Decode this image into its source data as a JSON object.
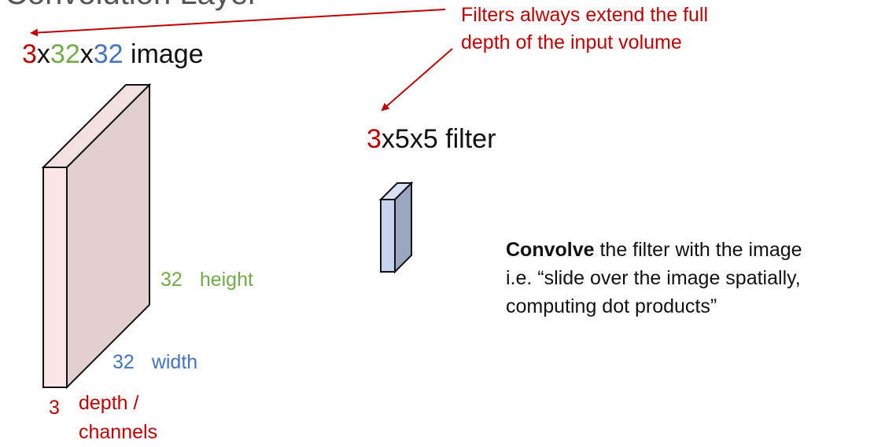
{
  "title_partial": "Convolution Layer",
  "image_label": {
    "depth": "3",
    "x1": "x",
    "height": "32",
    "x2": "x",
    "width": "32",
    "suffix": " image"
  },
  "filter_label": {
    "depth": "3",
    "rest": "x5x5 filter"
  },
  "note_top": {
    "line1": "Filters always extend the full",
    "line2": "depth of the input volume"
  },
  "dimensions": {
    "height_value": "32",
    "height_label": "height",
    "width_value": "32",
    "width_label": "width",
    "depth_value": "3",
    "depth_label": "depth / channels"
  },
  "convolve": {
    "bold": "Convolve",
    "line1_rest": " the filter with the image",
    "line2": "i.e. “slide over the image spatially,",
    "line3": "computing dot products”"
  },
  "colors": {
    "depth": "#c00000",
    "height": "#70ad47",
    "width": "#4472c4",
    "volume_front": "#fbe5e6",
    "volume_side": "#e2cfcf",
    "filter_front": "#c5d3f0",
    "filter_side": "#9aa6bf"
  }
}
